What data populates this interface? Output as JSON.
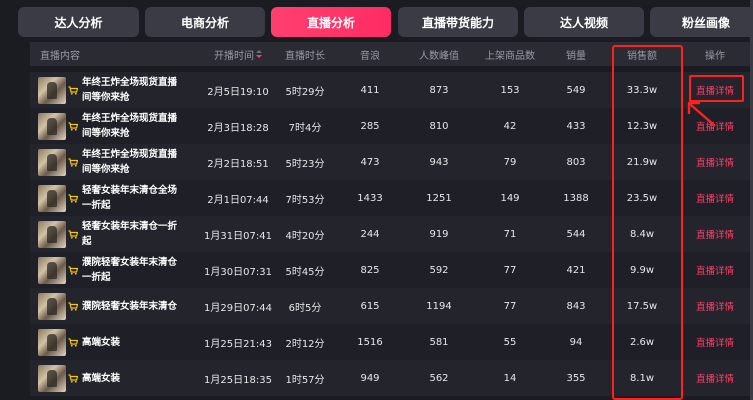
{
  "tabs": [
    {
      "label": "达人分析",
      "active": false
    },
    {
      "label": "电商分析",
      "active": false
    },
    {
      "label": "直播分析",
      "active": true
    },
    {
      "label": "直播带货能力",
      "active": false
    },
    {
      "label": "达人视频",
      "active": false
    },
    {
      "label": "粉丝画像",
      "active": false
    }
  ],
  "table": {
    "headers": {
      "content": "直播内容",
      "start_time": "开播时间",
      "duration": "直播时长",
      "sound_wave": "音浪",
      "peak_viewers": "人数峰值",
      "listed_products": "上架商品数",
      "sales_volume": "销量",
      "sales_amount": "销售额",
      "action": "操作"
    },
    "rows": [
      {
        "title": "年终王炸全场现货直播间等你来抢",
        "start_time": "2月5日19:10",
        "duration": "5时29分",
        "sound_wave": "411",
        "peak_viewers": "873",
        "listed_products": "153",
        "sales_volume": "549",
        "sales_amount": "33.3w",
        "action": "直播详情"
      },
      {
        "title": "年终王炸全场现货直播间等你来抢",
        "start_time": "2月3日18:28",
        "duration": "7时4分",
        "sound_wave": "285",
        "peak_viewers": "810",
        "listed_products": "42",
        "sales_volume": "433",
        "sales_amount": "12.3w",
        "action": "直播详情"
      },
      {
        "title": "年终王炸全场现货直播间等你来抢",
        "start_time": "2月2日18:51",
        "duration": "5时23分",
        "sound_wave": "473",
        "peak_viewers": "943",
        "listed_products": "79",
        "sales_volume": "803",
        "sales_amount": "21.9w",
        "action": "直播详情"
      },
      {
        "title": "轻奢女装年末清仓全场一折起",
        "start_time": "2月1日07:44",
        "duration": "7时53分",
        "sound_wave": "1433",
        "peak_viewers": "1251",
        "listed_products": "149",
        "sales_volume": "1388",
        "sales_amount": "23.5w",
        "action": "直播详情"
      },
      {
        "title": "轻奢女装年末清仓一折起",
        "start_time": "1月31日07:41",
        "duration": "4时20分",
        "sound_wave": "244",
        "peak_viewers": "919",
        "listed_products": "71",
        "sales_volume": "544",
        "sales_amount": "8.4w",
        "action": "直播详情"
      },
      {
        "title": "濮院轻奢女装年末清仓一折起",
        "start_time": "1月30日07:31",
        "duration": "5时45分",
        "sound_wave": "825",
        "peak_viewers": "592",
        "listed_products": "77",
        "sales_volume": "421",
        "sales_amount": "9.9w",
        "action": "直播详情"
      },
      {
        "title": "濮院轻奢女装年末清仓",
        "start_time": "1月29日07:44",
        "duration": "6时5分",
        "sound_wave": "615",
        "peak_viewers": "1194",
        "listed_products": "77",
        "sales_volume": "843",
        "sales_amount": "17.5w",
        "action": "直播详情"
      },
      {
        "title": "高端女装",
        "start_time": "1月25日21:43",
        "duration": "2时12分",
        "sound_wave": "1516",
        "peak_viewers": "581",
        "listed_products": "55",
        "sales_volume": "94",
        "sales_amount": "2.6w",
        "action": "直播详情"
      },
      {
        "title": "高端女装",
        "start_time": "1月25日18:35",
        "duration": "1时57分",
        "sound_wave": "949",
        "peak_viewers": "562",
        "listed_products": "14",
        "sales_volume": "355",
        "sales_amount": "8.1w",
        "action": "直播详情"
      }
    ]
  },
  "colors": {
    "accent": "#ff3f70",
    "annotation": "#ff2020",
    "background": "#1b1c22",
    "cart_icon": "#f5c518"
  }
}
